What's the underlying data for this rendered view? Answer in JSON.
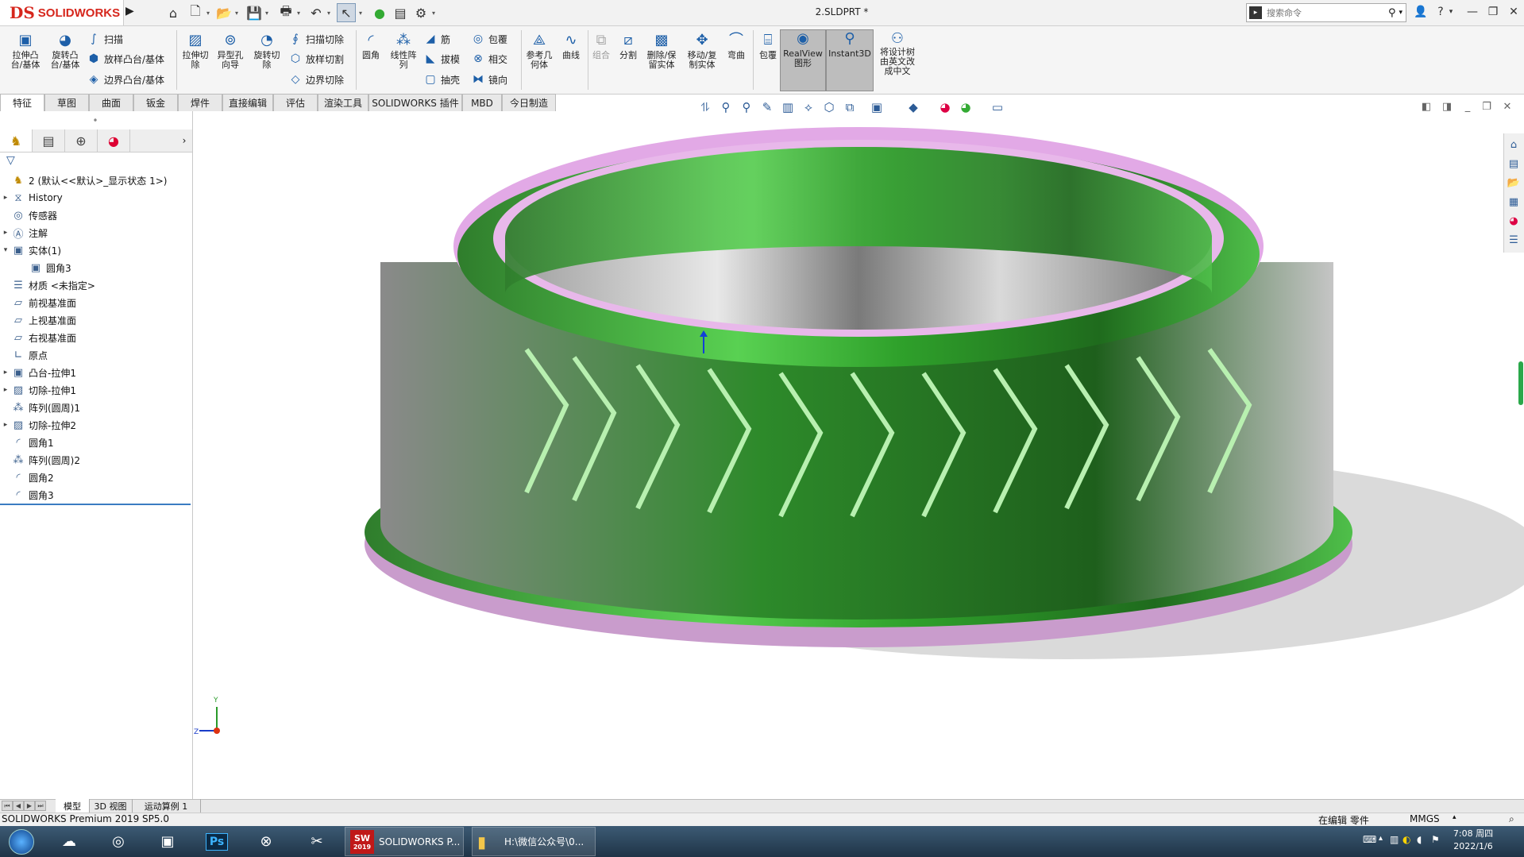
{
  "app": {
    "logo_ds": "DS",
    "logo_text": "SOLIDWORKS",
    "doc_title": "2.SLDPRT *",
    "search_placeholder": "搜索命令"
  },
  "colors": {
    "accent_blue": "#1d5fa8",
    "brand_red": "#d6261c",
    "tree_selection": "#3a7cc2",
    "model_green": "#3fb83b",
    "model_pink": "#e7b7e9"
  },
  "command_manager": {
    "extrude_boss": "拉伸凸\n台/基体",
    "revolve_boss": "旋转凸\n台/基体",
    "sweep": "扫描",
    "loft_boss": "放样凸台/基体",
    "boundary_boss": "边界凸台/基体",
    "extrude_cut": "拉伸切\n除",
    "hole_wizard": "异型孔\n向导",
    "revolve_cut": "旋转切\n除",
    "sweep_cut": "扫描切除",
    "loft_cut": "放样切割",
    "boundary_cut": "边界切除",
    "fillet": "圆角",
    "linear_pattern": "线性阵\n列",
    "rib": "筋",
    "draft": "拔模",
    "shell": "抽壳",
    "wrap": "包覆",
    "intersect": "相交",
    "mirror": "镜向",
    "ref_geometry": "参考几\n何体",
    "curves": "曲线",
    "combine": "组合",
    "split": "分割",
    "delete_keep_body": "删除/保\n留实体",
    "move_copy_body": "移动/复\n制实体",
    "flex": "弯曲",
    "wrap2": "包覆",
    "realview": "RealView\n图形",
    "instant3d": "Instant3D",
    "translate_tree": "将设计树\n由英文改\n成中文"
  },
  "tabs": [
    "特征",
    "草图",
    "曲面",
    "钣金",
    "焊件",
    "直接编辑",
    "评估",
    "渲染工具",
    "SOLIDWORKS 插件",
    "MBD",
    "今日制造"
  ],
  "tree": [
    {
      "label": "2  (默认<<默认>_显示状态 1>)",
      "exp": ""
    },
    {
      "label": "History",
      "exp": "▸"
    },
    {
      "label": "传感器",
      "exp": ""
    },
    {
      "label": "注解",
      "exp": "▸"
    },
    {
      "label": "实体(1)",
      "exp": "▾"
    },
    {
      "label": "圆角3",
      "exp": ""
    },
    {
      "label": "材质 <未指定>",
      "exp": ""
    },
    {
      "label": "前视基准面",
      "exp": ""
    },
    {
      "label": "上视基准面",
      "exp": ""
    },
    {
      "label": "右视基准面",
      "exp": ""
    },
    {
      "label": "原点",
      "exp": ""
    },
    {
      "label": "凸台-拉伸1",
      "exp": "▸"
    },
    {
      "label": "切除-拉伸1",
      "exp": "▸"
    },
    {
      "label": "阵列(圆周)1",
      "exp": ""
    },
    {
      "label": "切除-拉伸2",
      "exp": "▸"
    },
    {
      "label": "圆角1",
      "exp": ""
    },
    {
      "label": "阵列(圆周)2",
      "exp": ""
    },
    {
      "label": "圆角2",
      "exp": ""
    },
    {
      "label": "圆角3",
      "exp": ""
    }
  ],
  "bottom_tabs": [
    "模型",
    "3D 视图",
    "运动算例 1"
  ],
  "status": {
    "left": "SOLIDWORKS Premium 2019 SP5.0",
    "mode": "在编辑 零件",
    "units": "MMGS"
  },
  "triad": {
    "y": "Y",
    "z": "Z"
  },
  "taskbar": {
    "sw_task": "SOLIDWORKS P...",
    "folder_task": "H:\\微信公众号\\0...",
    "sw_badge": "2019",
    "time": "7:08 周四",
    "date": "2022/1/6"
  }
}
